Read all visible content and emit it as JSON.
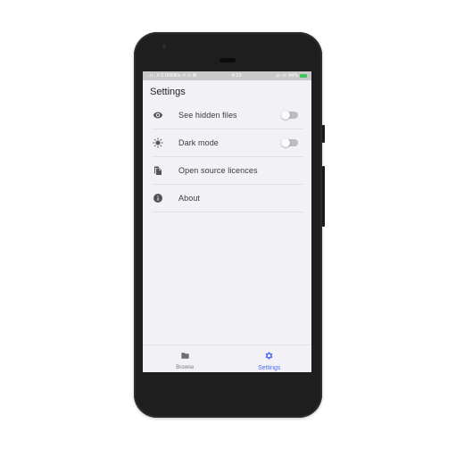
{
  "status_bar": {
    "left_text": "..ıl ..ıl 0.00KB/s ☼ ⊙ ⌘",
    "time": "4:23",
    "right_text": "◎ ◁ᵒ 94%",
    "battery_color": "#3cc55a"
  },
  "page": {
    "title": "Settings"
  },
  "settings": {
    "items": [
      {
        "icon": "eye-icon",
        "label": "See hidden files",
        "toggle": false
      },
      {
        "icon": "brightness-icon",
        "label": "Dark mode",
        "toggle": false
      },
      {
        "icon": "file-copy-icon",
        "label": "Open source licences"
      },
      {
        "icon": "info-icon",
        "label": "About"
      }
    ]
  },
  "bottom_nav": {
    "items": [
      {
        "icon": "folder-icon",
        "label": "Browse",
        "active": false
      },
      {
        "icon": "gear-icon",
        "label": "Settings",
        "active": true
      }
    ],
    "active_color": "#4a6cf7",
    "inactive_color": "#7a7a7a"
  }
}
